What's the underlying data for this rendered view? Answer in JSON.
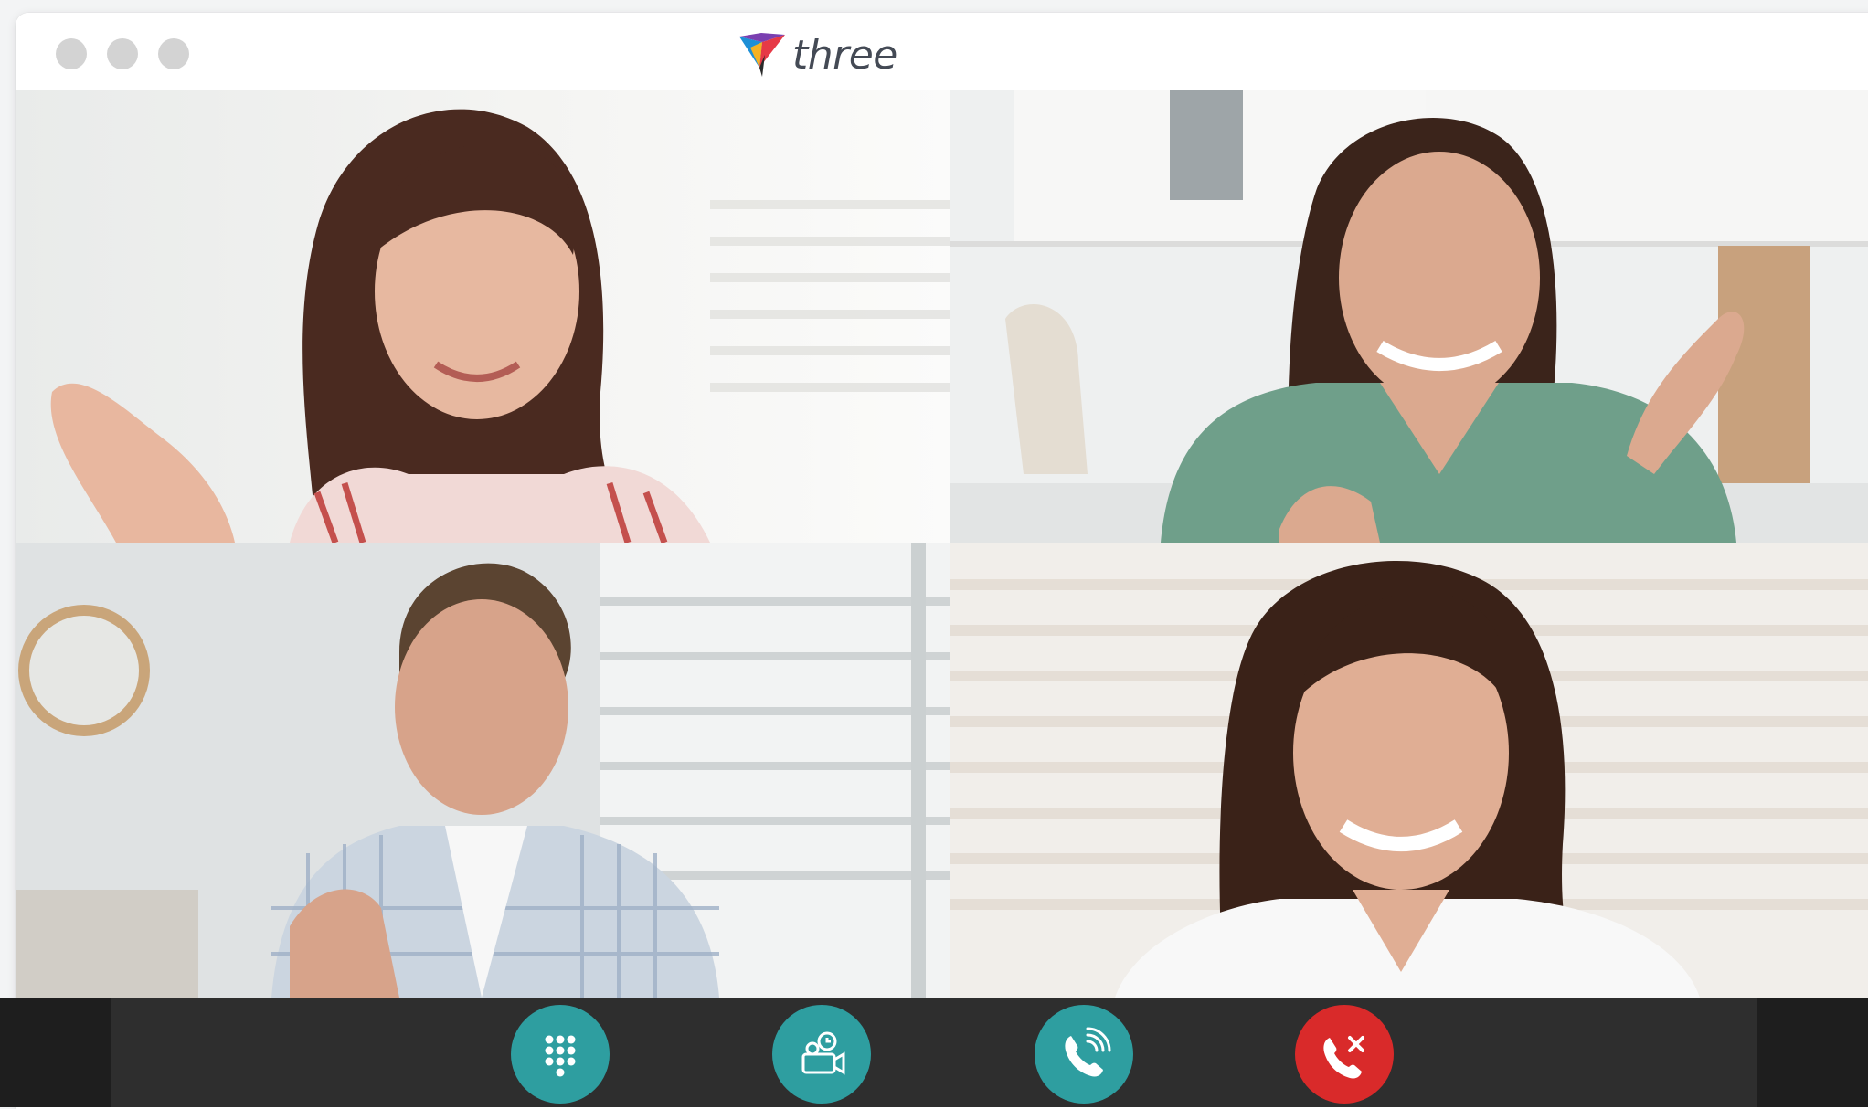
{
  "app": {
    "brand": "three",
    "accent_color": "#2e9ea0",
    "hangup_color": "#d92a2a"
  },
  "window_controls": [
    {
      "name": "close-dot",
      "color": "#d3d3d3"
    },
    {
      "name": "minimize-dot",
      "color": "#d3d3d3"
    },
    {
      "name": "maximize-dot",
      "color": "#d3d3d3"
    }
  ],
  "participants": [
    {
      "id": "participant-1"
    },
    {
      "id": "participant-2"
    },
    {
      "id": "participant-3"
    },
    {
      "id": "participant-4"
    }
  ],
  "controls": [
    {
      "id": "dialpad-button",
      "icon": "dialpad-icon"
    },
    {
      "id": "video-button",
      "icon": "video-camera-icon"
    },
    {
      "id": "call-button",
      "icon": "phone-ringing-icon"
    },
    {
      "id": "hangup-button",
      "icon": "end-call-icon"
    }
  ]
}
